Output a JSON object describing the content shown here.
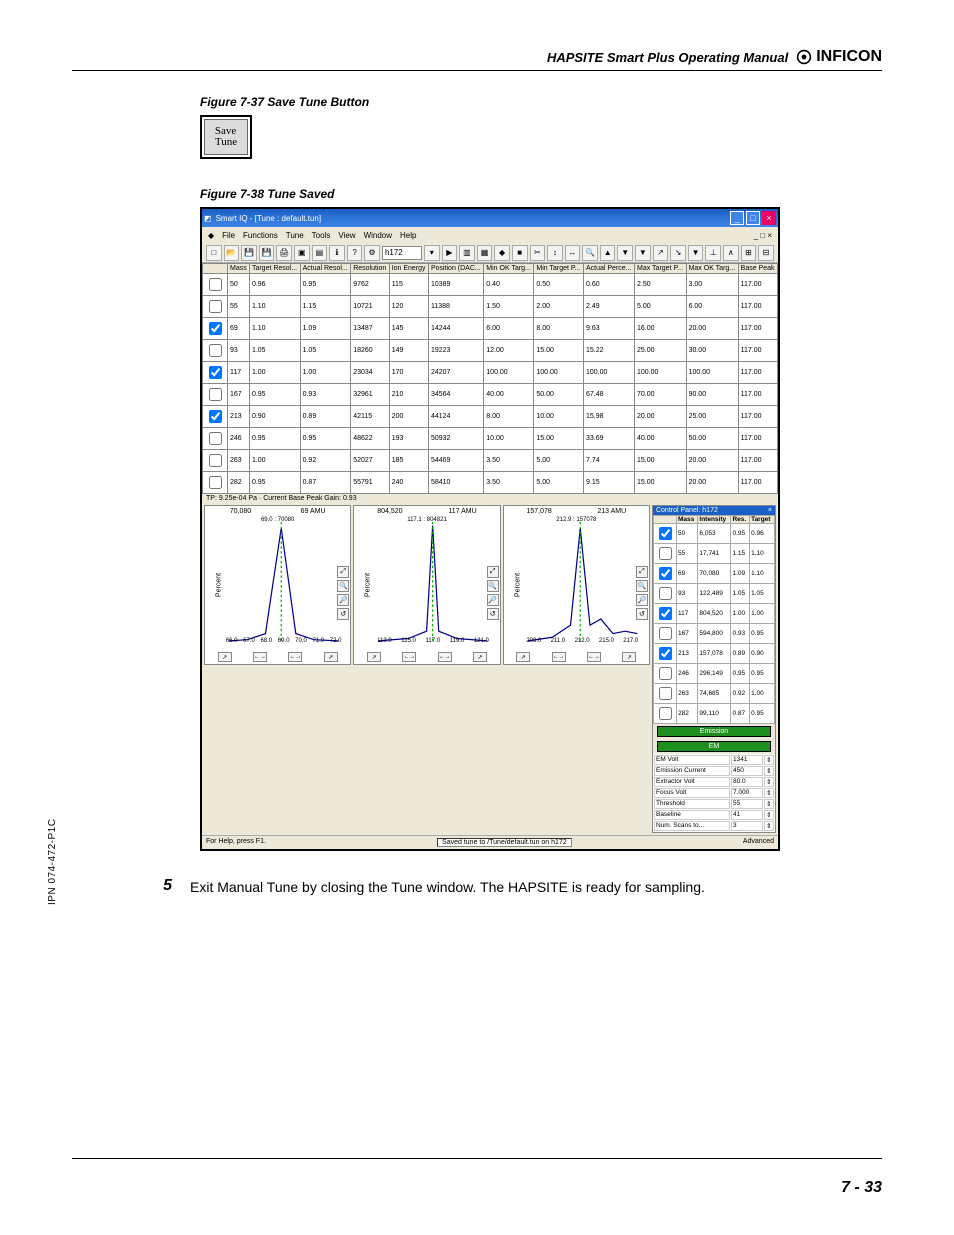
{
  "header": {
    "manual_title": "HAPSITE Smart Plus Operating Manual",
    "brand": "INFICON"
  },
  "figure37": {
    "caption": "Figure 7-37  Save Tune Button",
    "btn_line1": "Save",
    "btn_line2": "Tune"
  },
  "figure38": {
    "caption": "Figure 7-38  Tune Saved"
  },
  "app": {
    "title": "Smart IQ - [Tune : default.tun]",
    "menu": [
      "File",
      "Functions",
      "Tune",
      "Tools",
      "View",
      "Window",
      "Help"
    ],
    "input_val": "h172",
    "tp_line": "TP: 9.25e-04 Pa · Current Base Peak Gain: 0.93",
    "columns": [
      "",
      "Mass",
      "Target Resol...",
      "Actual Resol...",
      "Resolution",
      "Ion Energy",
      "Position (DAC...",
      "Min OK Targ...",
      "Min Target P...",
      "Actual Perce...",
      "Max Target P...",
      "Max OK Targ...",
      "Base Peak"
    ],
    "rows": [
      {
        "chk": false,
        "m": "50",
        "tr": "0.96",
        "ar": "0.95",
        "res": "9762",
        "ie": "115",
        "pos": "10389",
        "min": "0.40",
        "mint": "0.50",
        "act": "0.60",
        "maxt": "2.50",
        "maxok": "3.00",
        "bp": "117.00"
      },
      {
        "chk": false,
        "m": "55",
        "tr": "1.10",
        "ar": "1.15",
        "res": "10721",
        "ie": "120",
        "pos": "11388",
        "min": "1.50",
        "mint": "2.00",
        "act": "2.49",
        "maxt": "5.00",
        "maxok": "6.00",
        "bp": "117.00"
      },
      {
        "chk": true,
        "m": "69",
        "tr": "1.10",
        "ar": "1.09",
        "res": "13487",
        "ie": "145",
        "pos": "14244",
        "min": "6.00",
        "mint": "8.00",
        "act": "9.63",
        "maxt": "16.00",
        "maxok": "20.00",
        "bp": "117.00"
      },
      {
        "chk": false,
        "m": "93",
        "tr": "1.05",
        "ar": "1.05",
        "res": "18260",
        "ie": "149",
        "pos": "19223",
        "min": "12.00",
        "mint": "15.00",
        "act": "15.22",
        "maxt": "25.00",
        "maxok": "30.00",
        "bp": "117.00"
      },
      {
        "chk": true,
        "m": "117",
        "tr": "1.00",
        "ar": "1.00",
        "res": "23034",
        "ie": "170",
        "pos": "24207",
        "min": "100.00",
        "mint": "100.00",
        "act": "100.00",
        "maxt": "100.00",
        "maxok": "100.00",
        "bp": "117.00"
      },
      {
        "chk": false,
        "m": "167",
        "tr": "0.95",
        "ar": "0.93",
        "res": "32961",
        "ie": "210",
        "pos": "34564",
        "min": "40.00",
        "mint": "50.00",
        "act": "67.48",
        "maxt": "70.00",
        "maxok": "90.00",
        "bp": "117.00"
      },
      {
        "chk": true,
        "m": "213",
        "tr": "0.90",
        "ar": "0.89",
        "res": "42115",
        "ie": "200",
        "pos": "44124",
        "min": "8.00",
        "mint": "10.00",
        "act": "15.98",
        "maxt": "20.00",
        "maxok": "25.00",
        "bp": "117.00"
      },
      {
        "chk": false,
        "m": "246",
        "tr": "0.95",
        "ar": "0.95",
        "res": "48622",
        "ie": "193",
        "pos": "50932",
        "min": "10.00",
        "mint": "15.00",
        "act": "33.69",
        "maxt": "40.00",
        "maxok": "50.00",
        "bp": "117.00"
      },
      {
        "chk": false,
        "m": "263",
        "tr": "1.00",
        "ar": "0.92",
        "res": "52027",
        "ie": "185",
        "pos": "54469",
        "min": "3.50",
        "mint": "5.00",
        "act": "7.74",
        "maxt": "15.00",
        "maxok": "20.00",
        "bp": "117.00"
      },
      {
        "chk": false,
        "m": "282",
        "tr": "0.95",
        "ar": "0.87",
        "res": "55791",
        "ie": "240",
        "pos": "58410",
        "min": "3.50",
        "mint": "5.00",
        "act": "9.15",
        "maxt": "15.00",
        "maxok": "20.00",
        "bp": "117.00"
      }
    ],
    "status_left": "For Help, press F1.",
    "status_saved": "Saved tune to /Tune/default.tun on h172",
    "status_right": "Advanced"
  },
  "chart1": {
    "peak": "70,080",
    "sub": "69.0 : 70080",
    "amu": "69 AMU",
    "ylabel": "Percent",
    "xticks": [
      "66.0",
      "67.0",
      "68.0",
      "69.0",
      "70.0",
      "71.0",
      "72.0"
    ]
  },
  "chart2": {
    "peak": "804,520",
    "sub": "117.1 : 804821",
    "amu": "117 AMU",
    "ylabel": "Percent",
    "xticks": [
      "113.0",
      "115.0",
      "117.0",
      "119.0",
      "121.0"
    ]
  },
  "chart3": {
    "peak": "157,078",
    "sub": "212.9 : 157078",
    "amu": "213 AMU",
    "ylabel": "Percent",
    "xticks": [
      "208.0",
      "211.0",
      "212.0",
      "215.0",
      "217.0"
    ]
  },
  "control_panel": {
    "title": "Control Panel: h172",
    "headers": [
      "",
      "Mass",
      "Intensity",
      "Res.",
      "Target"
    ],
    "rows": [
      {
        "chk": true,
        "m": "50",
        "i": "6,053",
        "r": "0.95",
        "t": "0.96"
      },
      {
        "chk": false,
        "m": "55",
        "i": "17,741",
        "r": "1.15",
        "t": "1.10"
      },
      {
        "chk": true,
        "m": "69",
        "i": "70,080",
        "r": "1.09",
        "t": "1.10"
      },
      {
        "chk": false,
        "m": "93",
        "i": "122,489",
        "r": "1.05",
        "t": "1.05"
      },
      {
        "chk": true,
        "m": "117",
        "i": "804,520",
        "r": "1.00",
        "t": "1.00"
      },
      {
        "chk": false,
        "m": "167",
        "i": "594,800",
        "r": "0.93",
        "t": "0.95"
      },
      {
        "chk": true,
        "m": "213",
        "i": "157,078",
        "r": "0.89",
        "t": "0.90"
      },
      {
        "chk": false,
        "m": "246",
        "i": "296,149",
        "r": "0.95",
        "t": "0.95"
      },
      {
        "chk": false,
        "m": "263",
        "i": "74,685",
        "r": "0.92",
        "t": "1.00"
      },
      {
        "chk": false,
        "m": "282",
        "i": "99,110",
        "r": "0.87",
        "t": "0.95"
      }
    ],
    "em_emission": "Emission",
    "em_em": "EM",
    "kv": [
      {
        "k": "EM Volt",
        "v": "1341"
      },
      {
        "k": "Emission Current",
        "v": "450"
      },
      {
        "k": "Extractor Volt",
        "v": "80.0"
      },
      {
        "k": "Focus Volt",
        "v": "7.000"
      },
      {
        "k": "Threshold",
        "v": "55"
      },
      {
        "k": "Baseline",
        "v": "41"
      },
      {
        "k": "Num. Scans to...",
        "v": "3"
      }
    ]
  },
  "step": {
    "num": "5",
    "text": "Exit Manual Tune by closing the Tune window. The HAPSITE is ready for sampling."
  },
  "footer": {
    "ipn": "IPN 074-472-P1C",
    "page": "7 - 33"
  },
  "chart_data": [
    {
      "type": "line",
      "title": "69 AMU peak",
      "x": [
        66,
        67,
        68,
        69,
        70,
        71,
        72
      ],
      "y": [
        0,
        0,
        1,
        15,
        1,
        0,
        0
      ],
      "ylim": [
        0,
        16
      ],
      "xlabel": "",
      "ylabel": "Percent"
    },
    {
      "type": "line",
      "title": "117 AMU peak",
      "x": [
        113,
        115,
        117,
        119,
        121
      ],
      "y": [
        0,
        2,
        100,
        2,
        0
      ],
      "ylim": [
        0,
        100
      ],
      "xlabel": "",
      "ylabel": "Percent"
    },
    {
      "type": "line",
      "title": "213 AMU peak",
      "x": [
        208,
        211,
        212,
        213,
        215,
        217
      ],
      "y": [
        0,
        1,
        3,
        20,
        2,
        1
      ],
      "ylim": [
        0,
        20
      ],
      "xlabel": "",
      "ylabel": "Percent"
    }
  ]
}
